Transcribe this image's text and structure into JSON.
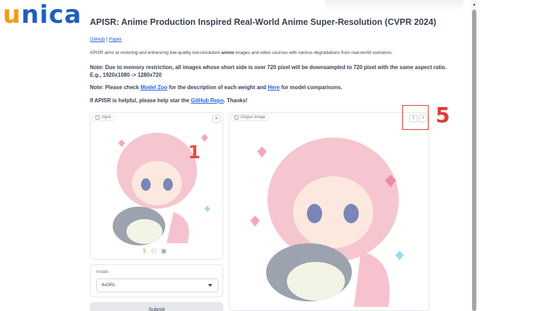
{
  "watermark": {
    "logo_first": "u",
    "logo_rest": "nica"
  },
  "header": {
    "title": "APISR: Anime Production Inspired Real-World Anime Super-Resolution (CVPR 2024)",
    "links": {
      "github": "GitHub",
      "separator": "|",
      "paper": "Paper"
    }
  },
  "description": {
    "before": "APISR aims at restoring and enhancing low-quality low-resolution ",
    "bold": "anime",
    "after": " images and video sources with various degradations from real-world scenarios."
  },
  "note1": {
    "line1": "Note: Due to memory restriction, all images whose short side is over 720 pixel will be downsampled to 720 pixel with the same aspect ratio.",
    "line2": "E.g., 1920x1080 -> 1280x720"
  },
  "note2": {
    "before": "Note: Please check ",
    "link1": "Model Zoo",
    "middle": " for the description of each weight and ",
    "link2": "Here",
    "after": " for model comparisons."
  },
  "star": {
    "before": "If APISR is helpful, please help star the ",
    "link": "GitHub Repo",
    "after": ". Thanks!"
  },
  "input_panel": {
    "label": "Input",
    "close": "×",
    "tools": [
      "⇪",
      "⚇",
      "▣"
    ]
  },
  "output_panel": {
    "label": "Output image",
    "download": "⇩",
    "share": "<"
  },
  "annotations": {
    "a1": "1",
    "a5": "5"
  },
  "model": {
    "label": "model",
    "selected": "4xGRL"
  },
  "submit": {
    "label": "Submit"
  },
  "colors": {
    "accent": "#e53935",
    "link": "#2563eb",
    "logo_orange": "#f39c12",
    "logo_blue": "#1f5fbf"
  },
  "icons": [
    "image-icon",
    "close-icon",
    "upload-icon",
    "webcam-icon",
    "clipboard-icon",
    "download-icon",
    "share-icon",
    "chevron-down-icon"
  ]
}
